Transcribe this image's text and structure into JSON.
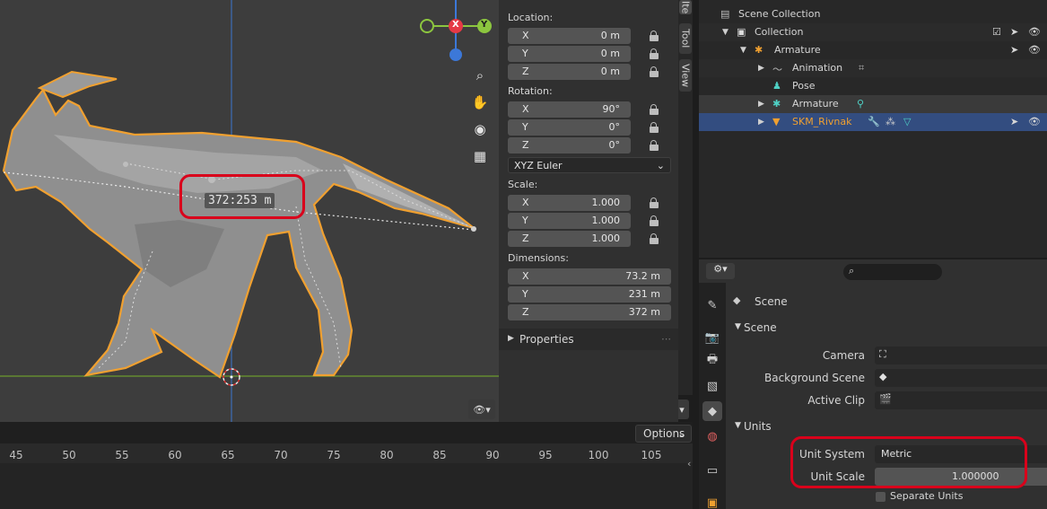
{
  "viewport": {
    "measurement": "372:253 m",
    "gizmo": {
      "x": "X",
      "y": "Y"
    },
    "colors": {
      "accent": "#f0a030",
      "x_axis": "#e63946",
      "y_axis": "#8cc63f",
      "z_axis": "#3c78d8",
      "annotation": "#d9001b"
    }
  },
  "npanel": {
    "location_label": "Location:",
    "location": [
      {
        "axis": "X",
        "value": "0 m"
      },
      {
        "axis": "Y",
        "value": "0 m"
      },
      {
        "axis": "Z",
        "value": "0 m"
      }
    ],
    "rotation_label": "Rotation:",
    "rotation": [
      {
        "axis": "X",
        "value": "90°"
      },
      {
        "axis": "Y",
        "value": "0°"
      },
      {
        "axis": "Z",
        "value": "0°"
      }
    ],
    "rotation_mode": "XYZ Euler",
    "scale_label": "Scale:",
    "scale": [
      {
        "axis": "X",
        "value": "1.000"
      },
      {
        "axis": "Y",
        "value": "1.000"
      },
      {
        "axis": "Z",
        "value": "1.000"
      }
    ],
    "dimensions_label": "Dimensions:",
    "dimensions": [
      {
        "axis": "X",
        "value": "73.2 m"
      },
      {
        "axis": "Y",
        "value": "231 m"
      },
      {
        "axis": "Z",
        "value": "372 m"
      }
    ],
    "properties_label": "Properties"
  },
  "side_tabs": [
    "Ite",
    "Tool",
    "View"
  ],
  "timeline": {
    "options_label": "Options",
    "ticks": [
      "45",
      "50",
      "55",
      "60",
      "65",
      "70",
      "75",
      "80",
      "85",
      "90",
      "95",
      "100",
      "105"
    ]
  },
  "outliner": {
    "rows": [
      {
        "label": "Scene Collection"
      },
      {
        "label": "Collection"
      },
      {
        "label": "Armature"
      },
      {
        "label": "Animation"
      },
      {
        "label": "Pose"
      },
      {
        "label": "Armature"
      },
      {
        "label": "SKM_Rivnak"
      }
    ]
  },
  "properties": {
    "search_placeholder": "",
    "header": "Scene",
    "scene_section": "Scene",
    "camera_label": "Camera",
    "background_scene_label": "Background Scene",
    "active_clip_label": "Active Clip",
    "units_section": "Units",
    "unit_system_label": "Unit System",
    "unit_system_value": "Metric",
    "unit_scale_label": "Unit Scale",
    "unit_scale_value": "1.000000",
    "separate_units_label": "Separate Units"
  }
}
